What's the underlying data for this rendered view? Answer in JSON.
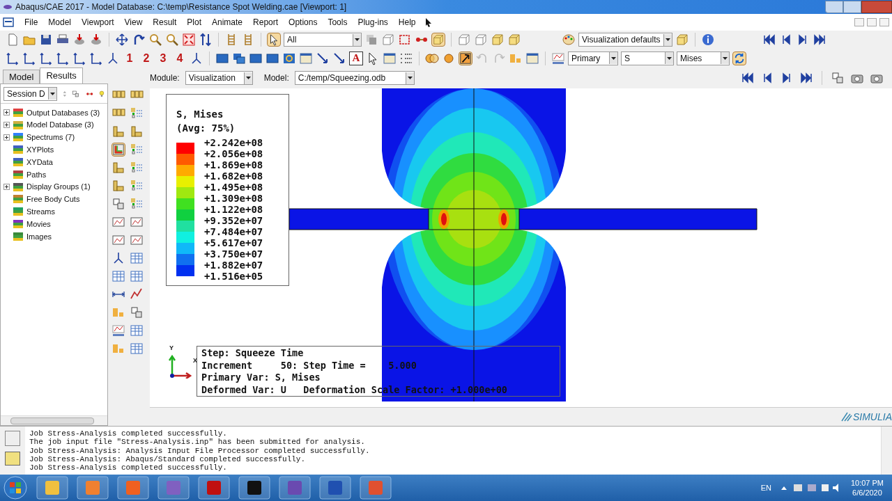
{
  "window": {
    "title": "Abaqus/CAE 2017 - Model Database: C:\\temp\\Resistance Spot Welding.cae [Viewport: 1]"
  },
  "menu": [
    "File",
    "Model",
    "Viewport",
    "View",
    "Result",
    "Plot",
    "Animate",
    "Report",
    "Options",
    "Tools",
    "Plug-ins",
    "Help"
  ],
  "toolbar": {
    "selection_filter": "All",
    "view_numbers": [
      "1",
      "2",
      "3",
      "4"
    ],
    "text_tool": "A",
    "render_style": "Visualization defaults",
    "field_output": [
      "Primary",
      "S",
      "Mises"
    ]
  },
  "context_bar": {
    "module_label": "Module:",
    "module": "Visualization",
    "model_label": "Model:",
    "model": "C:/temp/Squeezing.odb"
  },
  "panel_tabs": [
    {
      "label": "Model",
      "selected": false
    },
    {
      "label": "Results",
      "selected": true
    }
  ],
  "session_combo": "Session D",
  "tree": [
    {
      "label": "Output Databases (3)",
      "expandable": true
    },
    {
      "label": "Model Database (3)",
      "expandable": true
    },
    {
      "label": "Spectrums (7)",
      "expandable": true
    },
    {
      "label": "XYPlots",
      "expandable": false
    },
    {
      "label": "XYData",
      "expandable": false
    },
    {
      "label": "Paths",
      "expandable": false
    },
    {
      "label": "Display Groups (1)",
      "expandable": true
    },
    {
      "label": "Free Body Cuts",
      "expandable": false
    },
    {
      "label": "Streams",
      "expandable": false
    },
    {
      "label": "Movies",
      "expandable": false
    },
    {
      "label": "Images",
      "expandable": false
    }
  ],
  "legend": {
    "title": "S, Mises",
    "subtitle": "(Avg: 75%)",
    "entries": [
      {
        "value": "+2.242e+08",
        "color": "#ff0000"
      },
      {
        "value": "+2.056e+08",
        "color": "#ff5a00"
      },
      {
        "value": "+1.869e+08",
        "color": "#ffaa00"
      },
      {
        "value": "+1.682e+08",
        "color": "#e8f000"
      },
      {
        "value": "+1.495e+08",
        "color": "#a0e810"
      },
      {
        "value": "+1.309e+08",
        "color": "#40e020"
      },
      {
        "value": "+1.122e+08",
        "color": "#10d040"
      },
      {
        "value": "+9.352e+07",
        "color": "#20e0a0"
      },
      {
        "value": "+7.484e+07",
        "color": "#10f0e0"
      },
      {
        "value": "+5.617e+07",
        "color": "#10b8f8"
      },
      {
        "value": "+3.750e+07",
        "color": "#1070f0"
      },
      {
        "value": "+1.882e+07",
        "color": "#0030f0"
      },
      {
        "value": "+1.516e+05"
      }
    ]
  },
  "triad": {
    "y": "Y",
    "x": "X"
  },
  "info_box": [
    "Step: Squeeze Time",
    "Increment     50: Step Time =    5.000",
    "Primary Var: S, Mises",
    "Deformed Var: U   Deformation Scale Factor: +1.000e+00"
  ],
  "brand": "SIMULIA",
  "messages": [
    "Job Stress-Analysis completed successfully.",
    "The job input file \"Stress-Analysis.inp\" has been submitted for analysis.",
    "Job Stress-Analysis: Analysis Input File Processor completed successfully.",
    "Job Stress-Analysis: Abaqus/Standard completed successfully.",
    "Job Stress-Analysis completed successfully."
  ],
  "taskbar": {
    "language": "EN",
    "time": "10:07 PM",
    "date": "6/6/2020"
  }
}
